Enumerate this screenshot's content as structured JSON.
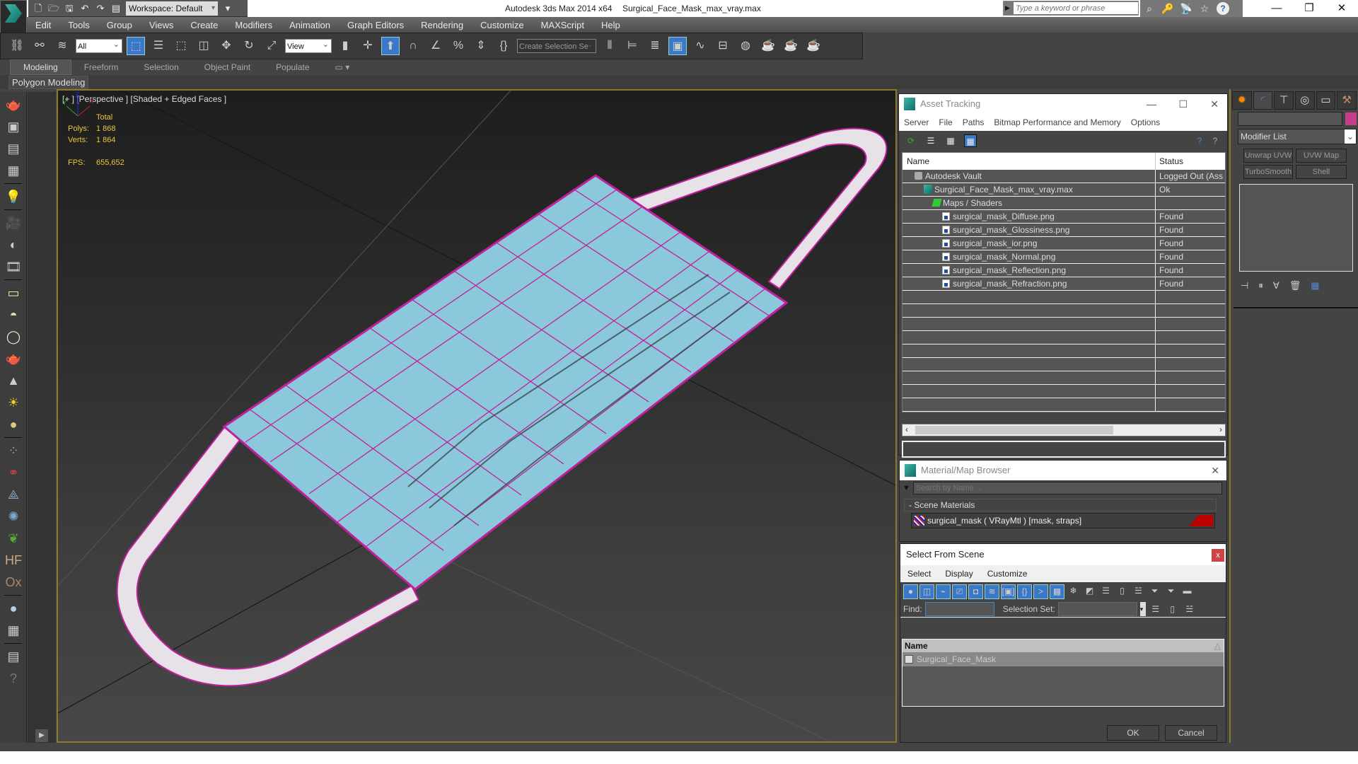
{
  "titlebar": {
    "app_title": "Autodesk 3ds Max  2014 x64",
    "file_title": "Surgical_Face_Mask_max_vray.max",
    "workspace": "Workspace: Default",
    "search_placeholder": "Type a keyword or phrase",
    "window_controls": [
      "minimize",
      "restore",
      "close"
    ]
  },
  "menu": [
    "Edit",
    "Tools",
    "Group",
    "Views",
    "Create",
    "Modifiers",
    "Animation",
    "Graph Editors",
    "Rendering",
    "Customize",
    "MAXScript",
    "Help"
  ],
  "toolbar": {
    "selection_filter": "All",
    "ref_coord": "View",
    "named_selection_placeholder": "Create Selection Se"
  },
  "ribbon": {
    "tabs": [
      "Modeling",
      "Freeform",
      "Selection",
      "Object Paint",
      "Populate"
    ],
    "active_tab": "Modeling",
    "panel": "Polygon Modeling"
  },
  "viewport": {
    "label": "[+ ] [Perspective ] [Shaded + Edged Faces ]",
    "stats_header": "Total",
    "polys_label": "Polys:",
    "polys": "1 868",
    "verts_label": "Verts:",
    "verts": "1 864",
    "fps_label": "FPS:",
    "fps": "655,652",
    "axis": {
      "x": "X",
      "y": "Y",
      "z": "Z"
    },
    "colors": {
      "mask": "#8cc8dc",
      "wire": "#c0209c",
      "strap": "#e8e4ea"
    }
  },
  "asset_tracking": {
    "title": "Asset Tracking",
    "menu": [
      "Server",
      "File",
      "Paths",
      "Bitmap Performance and Memory",
      "Options"
    ],
    "columns": [
      "Name",
      "Status"
    ],
    "rows": [
      {
        "name": "Autodesk Vault",
        "status": "Logged Out (Ass",
        "indent": 1,
        "icon": "vault-icon"
      },
      {
        "name": "Surgical_Face_Mask_max_vray.max",
        "status": "Ok",
        "indent": 2,
        "icon": "max-file-icon"
      },
      {
        "name": "Maps / Shaders",
        "status": "",
        "indent": 3,
        "icon": "maps-icon"
      },
      {
        "name": "surgical_mask_Diffuse.png",
        "status": "Found",
        "indent": 4,
        "icon": "image-file-icon"
      },
      {
        "name": "surgical_mask_Glossiness.png",
        "status": "Found",
        "indent": 4,
        "icon": "image-file-icon"
      },
      {
        "name": "surgical_mask_ior.png",
        "status": "Found",
        "indent": 4,
        "icon": "image-file-icon"
      },
      {
        "name": "surgical_mask_Normal.png",
        "status": "Found",
        "indent": 4,
        "icon": "image-file-icon"
      },
      {
        "name": "surgical_mask_Reflection.png",
        "status": "Found",
        "indent": 4,
        "icon": "image-file-icon"
      },
      {
        "name": "surgical_mask_Refraction.png",
        "status": "Found",
        "indent": 4,
        "icon": "image-file-icon"
      }
    ],
    "path_value": ""
  },
  "material_browser": {
    "title": "Material/Map Browser",
    "search_placeholder": "Search by Name ...",
    "group": "- Scene Materials",
    "item": "surgical_mask  ( VRayMtl ) [mask, straps]"
  },
  "select_from_scene": {
    "title": "Select From Scene",
    "menu": [
      "Select",
      "Display",
      "Customize"
    ],
    "find_label": "Find:",
    "find_value": "",
    "selection_set_label": "Selection Set:",
    "selection_set_value": "",
    "column": "Name",
    "items": [
      "Surgical_Face_Mask"
    ],
    "ok": "OK",
    "cancel": "Cancel"
  },
  "command_panel": {
    "tabs": [
      "create",
      "modify",
      "hierarchy",
      "motion",
      "display",
      "utilities"
    ],
    "active_tab": "modify",
    "object_name": "",
    "object_color": "#c83c8c",
    "modifier_list": "Modifier List",
    "modifier_buttons": [
      "Unwrap UVW",
      "UVW Map",
      "TurboSmooth",
      "Shell"
    ]
  }
}
